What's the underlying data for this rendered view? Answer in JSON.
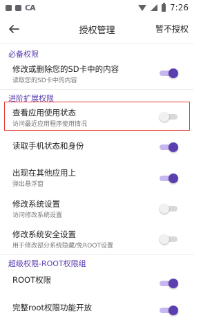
{
  "status_bar": {
    "carrier_text": "CA",
    "time": "7:26"
  },
  "toolbar": {
    "title": "授权管理",
    "action_label": "暂不授权"
  },
  "sections": [
    {
      "header": "必备权限",
      "items": [
        {
          "title": "修改或删除您的SD卡中的内容",
          "subtitle": "读取您的SD卡中的内容",
          "enabled": true
        }
      ]
    },
    {
      "header": "进阶扩展权限",
      "items": [
        {
          "title": "查看应用使用状态",
          "subtitle": "访问最近应用程序使用情况",
          "enabled": false
        },
        {
          "title": "读取手机状态和身份",
          "subtitle": "",
          "enabled": true
        },
        {
          "title": "出现在其他应用上",
          "subtitle": "弹出悬浮窗",
          "enabled": true
        },
        {
          "title": "修改系统设置",
          "subtitle": "访问修改系统设置",
          "enabled": false
        },
        {
          "title": "修改系统安全设置",
          "subtitle": "用于修改部分系统隐藏/免ROOT设置",
          "enabled": false
        }
      ]
    },
    {
      "header": "超级权限-ROOT权限组",
      "items": [
        {
          "title": "ROOT权限",
          "subtitle": "",
          "enabled": true
        },
        {
          "title": "完整root权限功能开放",
          "subtitle": "",
          "enabled": true
        }
      ]
    }
  ],
  "colors": {
    "accent": "#5b3fb0",
    "highlight_border": "#e53935"
  }
}
